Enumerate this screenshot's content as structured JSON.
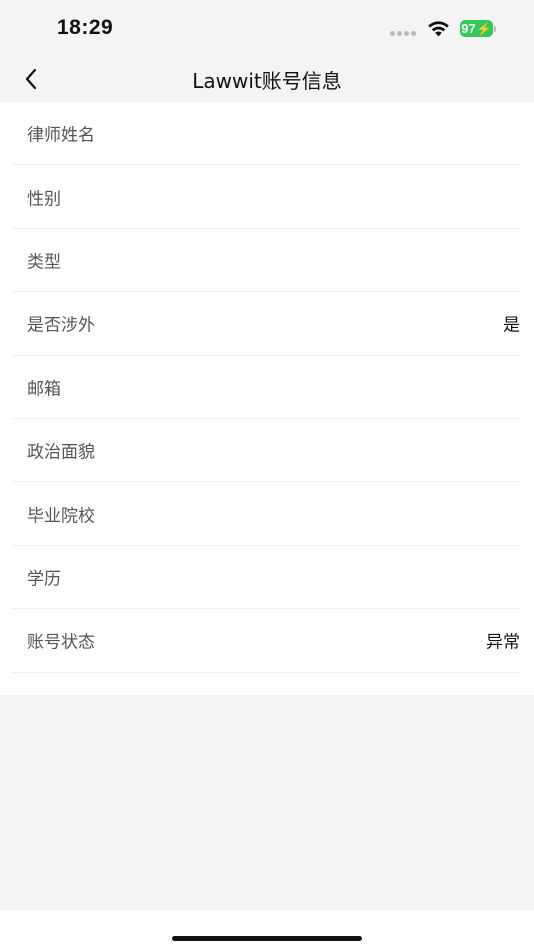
{
  "status_bar": {
    "time": "18:29",
    "battery_level": "97",
    "battery_color": "#34c759"
  },
  "nav": {
    "back_icon": "chevron-left-icon",
    "title": "Lawwit账号信息"
  },
  "fields": [
    {
      "label": "律师姓名",
      "value": ""
    },
    {
      "label": "性别",
      "value": ""
    },
    {
      "label": "类型",
      "value": ""
    },
    {
      "label": "是否涉外",
      "value": "是"
    },
    {
      "label": "邮箱",
      "value": ""
    },
    {
      "label": "政治面貌",
      "value": ""
    },
    {
      "label": "毕业院校",
      "value": ""
    },
    {
      "label": "学历",
      "value": ""
    },
    {
      "label": "账号状态",
      "value": "异常"
    }
  ]
}
